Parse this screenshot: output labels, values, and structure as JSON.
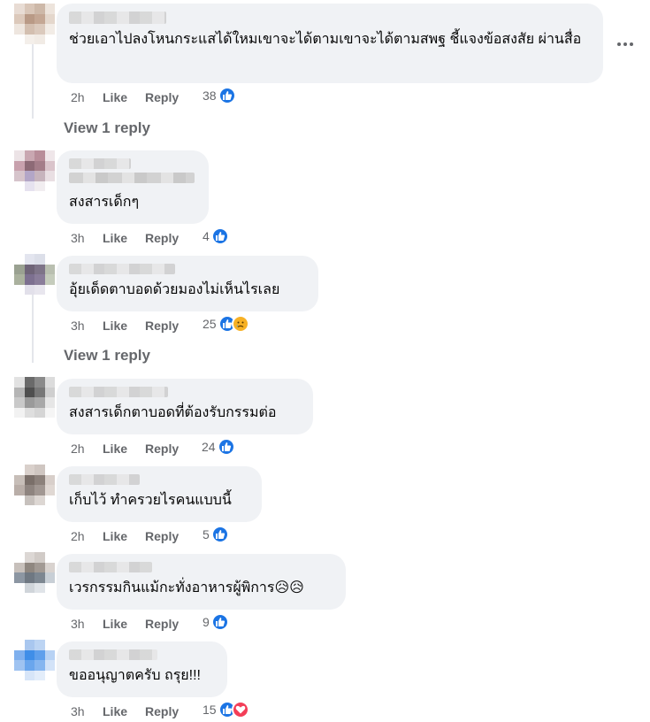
{
  "comments": [
    {
      "text": "ช่วยเอาไปลงโหนกระแสได้ใหมเขาจะได้ตามเขาจะได้ตามสพฐ ชี้แจงข้อสงสัย ผ่านสื่อ",
      "time": "2h",
      "like_label": "Like",
      "reply_label": "Reply",
      "reaction_count": "38",
      "reactions": [
        "like-icon"
      ]
    },
    {
      "text": "สงสารเด็กๆ",
      "time": "3h",
      "like_label": "Like",
      "reply_label": "Reply",
      "reaction_count": "4",
      "reactions": [
        "like-icon"
      ]
    },
    {
      "text": "อุ้ยเด็ดตาบอดด้วยมองไม่เห็นไรเลย",
      "time": "3h",
      "like_label": "Like",
      "reply_label": "Reply",
      "reaction_count": "25",
      "reactions": [
        "like-icon",
        "sad-icon"
      ]
    },
    {
      "text": "สงสารเด็กตาบอดที่ต้องรับกรรมต่อ",
      "time": "2h",
      "like_label": "Like",
      "reply_label": "Reply",
      "reaction_count": "24",
      "reactions": [
        "like-icon"
      ]
    },
    {
      "text": "เก็บไว้ ทำครวยไรคนแบบนี้",
      "time": "2h",
      "like_label": "Like",
      "reply_label": "Reply",
      "reaction_count": "5",
      "reactions": [
        "like-icon"
      ]
    },
    {
      "text": "เวรกรรมกินแม้กะทั่งอาหารผู้พิการ😥😥",
      "time": "3h",
      "like_label": "Like",
      "reply_label": "Reply",
      "reaction_count": "9",
      "reactions": [
        "like-icon"
      ]
    },
    {
      "text": "ขออนุญาตครับ ถรุย!!!",
      "time": "3h",
      "like_label": "Like",
      "reply_label": "Reply",
      "reaction_count": "15",
      "reactions": [
        "like-icon",
        "love-icon"
      ]
    }
  ],
  "view_replies": [
    "View 1 reply",
    "View 1 reply"
  ],
  "colors": {
    "like": "#1b74e4",
    "love": "#f33e58",
    "sad": "#f7b125",
    "bubble": "#f0f2f5",
    "meta": "#65676b"
  }
}
